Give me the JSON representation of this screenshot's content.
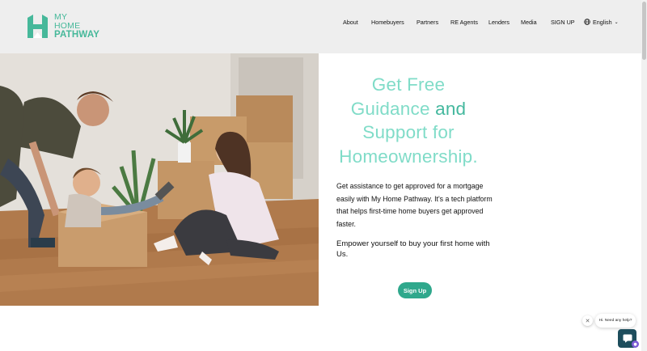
{
  "brand": {
    "line1": "MY",
    "line2": "HOME",
    "line3": "PATHWAY",
    "color": "#46b89a"
  },
  "nav": {
    "items": [
      {
        "label": "About"
      },
      {
        "label": "Homebuyers"
      },
      {
        "label": "Partners"
      },
      {
        "label": "RE Agents"
      },
      {
        "label": "Lenders"
      },
      {
        "label": "Media"
      },
      {
        "label": "SIGN UP"
      }
    ],
    "language": "English",
    "language_icon": "globe-icon",
    "dropdown_icon": "chevron-down-icon"
  },
  "hero": {
    "image_desc_icon": "family-moving-photo",
    "headline": {
      "l1": "Get Free",
      "l2a": "Guidance ",
      "l2b": "and",
      "l3": "Support for",
      "l4": "Homeownership."
    },
    "paragraph1": "Get assistance to get approved for a mortgage easily with My Home Pathway. It's a tech platform that helps first-time home buyers get approved faster.",
    "paragraph2": "Empower yourself to buy your first home with Us.",
    "cta": "Sign Up"
  },
  "chat": {
    "greeting": "Hi. Need any help?",
    "close_icon": "close-icon",
    "launcher_icon": "chat-icon",
    "badge_icon": "notification-icon"
  },
  "colors": {
    "accent_light": "#80dcc8",
    "accent_dark": "#44b89e",
    "button": "#2fa88c",
    "header_bg": "#eeeeee"
  }
}
